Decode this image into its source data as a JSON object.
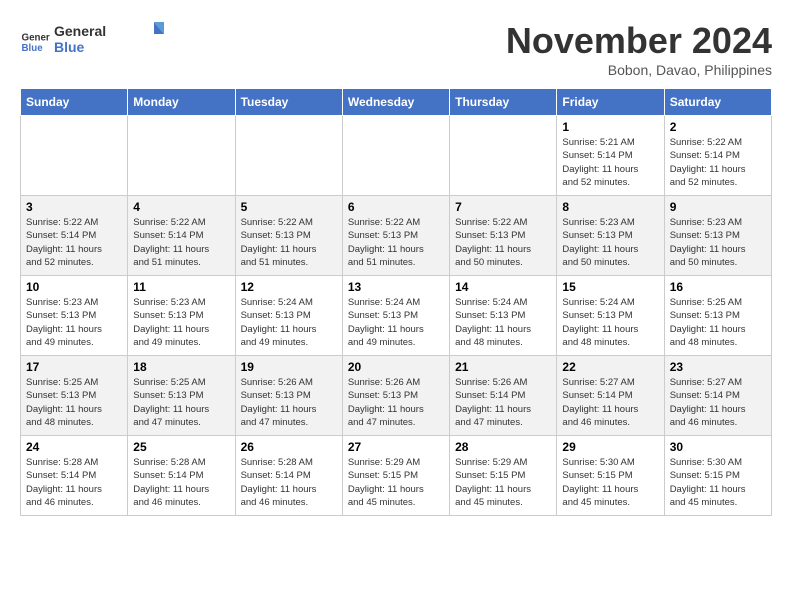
{
  "logo": {
    "line1": "General",
    "line2": "Blue"
  },
  "title": "November 2024",
  "subtitle": "Bobon, Davao, Philippines",
  "headers": [
    "Sunday",
    "Monday",
    "Tuesday",
    "Wednesday",
    "Thursday",
    "Friday",
    "Saturday"
  ],
  "weeks": [
    [
      {
        "day": "",
        "info": ""
      },
      {
        "day": "",
        "info": ""
      },
      {
        "day": "",
        "info": ""
      },
      {
        "day": "",
        "info": ""
      },
      {
        "day": "",
        "info": ""
      },
      {
        "day": "1",
        "info": "Sunrise: 5:21 AM\nSunset: 5:14 PM\nDaylight: 11 hours\nand 52 minutes."
      },
      {
        "day": "2",
        "info": "Sunrise: 5:22 AM\nSunset: 5:14 PM\nDaylight: 11 hours\nand 52 minutes."
      }
    ],
    [
      {
        "day": "3",
        "info": "Sunrise: 5:22 AM\nSunset: 5:14 PM\nDaylight: 11 hours\nand 52 minutes."
      },
      {
        "day": "4",
        "info": "Sunrise: 5:22 AM\nSunset: 5:14 PM\nDaylight: 11 hours\nand 51 minutes."
      },
      {
        "day": "5",
        "info": "Sunrise: 5:22 AM\nSunset: 5:13 PM\nDaylight: 11 hours\nand 51 minutes."
      },
      {
        "day": "6",
        "info": "Sunrise: 5:22 AM\nSunset: 5:13 PM\nDaylight: 11 hours\nand 51 minutes."
      },
      {
        "day": "7",
        "info": "Sunrise: 5:22 AM\nSunset: 5:13 PM\nDaylight: 11 hours\nand 50 minutes."
      },
      {
        "day": "8",
        "info": "Sunrise: 5:23 AM\nSunset: 5:13 PM\nDaylight: 11 hours\nand 50 minutes."
      },
      {
        "day": "9",
        "info": "Sunrise: 5:23 AM\nSunset: 5:13 PM\nDaylight: 11 hours\nand 50 minutes."
      }
    ],
    [
      {
        "day": "10",
        "info": "Sunrise: 5:23 AM\nSunset: 5:13 PM\nDaylight: 11 hours\nand 49 minutes."
      },
      {
        "day": "11",
        "info": "Sunrise: 5:23 AM\nSunset: 5:13 PM\nDaylight: 11 hours\nand 49 minutes."
      },
      {
        "day": "12",
        "info": "Sunrise: 5:24 AM\nSunset: 5:13 PM\nDaylight: 11 hours\nand 49 minutes."
      },
      {
        "day": "13",
        "info": "Sunrise: 5:24 AM\nSunset: 5:13 PM\nDaylight: 11 hours\nand 49 minutes."
      },
      {
        "day": "14",
        "info": "Sunrise: 5:24 AM\nSunset: 5:13 PM\nDaylight: 11 hours\nand 48 minutes."
      },
      {
        "day": "15",
        "info": "Sunrise: 5:24 AM\nSunset: 5:13 PM\nDaylight: 11 hours\nand 48 minutes."
      },
      {
        "day": "16",
        "info": "Sunrise: 5:25 AM\nSunset: 5:13 PM\nDaylight: 11 hours\nand 48 minutes."
      }
    ],
    [
      {
        "day": "17",
        "info": "Sunrise: 5:25 AM\nSunset: 5:13 PM\nDaylight: 11 hours\nand 48 minutes."
      },
      {
        "day": "18",
        "info": "Sunrise: 5:25 AM\nSunset: 5:13 PM\nDaylight: 11 hours\nand 47 minutes."
      },
      {
        "day": "19",
        "info": "Sunrise: 5:26 AM\nSunset: 5:13 PM\nDaylight: 11 hours\nand 47 minutes."
      },
      {
        "day": "20",
        "info": "Sunrise: 5:26 AM\nSunset: 5:13 PM\nDaylight: 11 hours\nand 47 minutes."
      },
      {
        "day": "21",
        "info": "Sunrise: 5:26 AM\nSunset: 5:14 PM\nDaylight: 11 hours\nand 47 minutes."
      },
      {
        "day": "22",
        "info": "Sunrise: 5:27 AM\nSunset: 5:14 PM\nDaylight: 11 hours\nand 46 minutes."
      },
      {
        "day": "23",
        "info": "Sunrise: 5:27 AM\nSunset: 5:14 PM\nDaylight: 11 hours\nand 46 minutes."
      }
    ],
    [
      {
        "day": "24",
        "info": "Sunrise: 5:28 AM\nSunset: 5:14 PM\nDaylight: 11 hours\nand 46 minutes."
      },
      {
        "day": "25",
        "info": "Sunrise: 5:28 AM\nSunset: 5:14 PM\nDaylight: 11 hours\nand 46 minutes."
      },
      {
        "day": "26",
        "info": "Sunrise: 5:28 AM\nSunset: 5:14 PM\nDaylight: 11 hours\nand 46 minutes."
      },
      {
        "day": "27",
        "info": "Sunrise: 5:29 AM\nSunset: 5:15 PM\nDaylight: 11 hours\nand 45 minutes."
      },
      {
        "day": "28",
        "info": "Sunrise: 5:29 AM\nSunset: 5:15 PM\nDaylight: 11 hours\nand 45 minutes."
      },
      {
        "day": "29",
        "info": "Sunrise: 5:30 AM\nSunset: 5:15 PM\nDaylight: 11 hours\nand 45 minutes."
      },
      {
        "day": "30",
        "info": "Sunrise: 5:30 AM\nSunset: 5:15 PM\nDaylight: 11 hours\nand 45 minutes."
      }
    ]
  ]
}
